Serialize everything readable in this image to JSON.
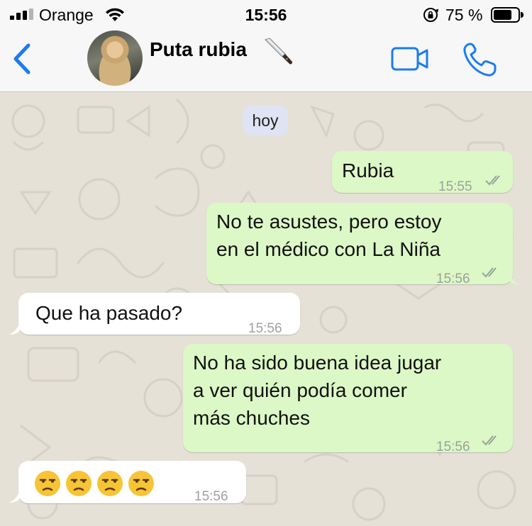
{
  "status_bar": {
    "carrier": "Orange",
    "time": "15:56",
    "battery_percent": "75 %"
  },
  "header": {
    "contact_name": "Puta rubia",
    "name_emoji": "knife-icon"
  },
  "chat": {
    "date_chip": "hoy",
    "messages": [
      {
        "direction": "out",
        "text": "Rubia",
        "time": "15:55",
        "status": "read"
      },
      {
        "direction": "out",
        "lines": [
          "No te asustes, pero estoy",
          "en el médico con La Niña"
        ],
        "time": "15:56",
        "status": "read"
      },
      {
        "direction": "in",
        "text": "Que ha pasado?",
        "time": "15:56"
      },
      {
        "direction": "out",
        "lines": [
          "No ha sido buena idea jugar",
          "a ver quién podía comer",
          "más chuches"
        ],
        "time": "15:56",
        "status": "read"
      },
      {
        "direction": "in",
        "emojis": [
          "unamused-face",
          "unamused-face",
          "unamused-face",
          "unamused-face"
        ],
        "time": "15:56"
      }
    ]
  },
  "colors": {
    "accent": "#1a7cf0",
    "outgoing_bubble": "#dcf8c6",
    "incoming_bubble": "#ffffff",
    "date_chip": "#dfe4f4",
    "chat_background": "#e5e1d7"
  }
}
